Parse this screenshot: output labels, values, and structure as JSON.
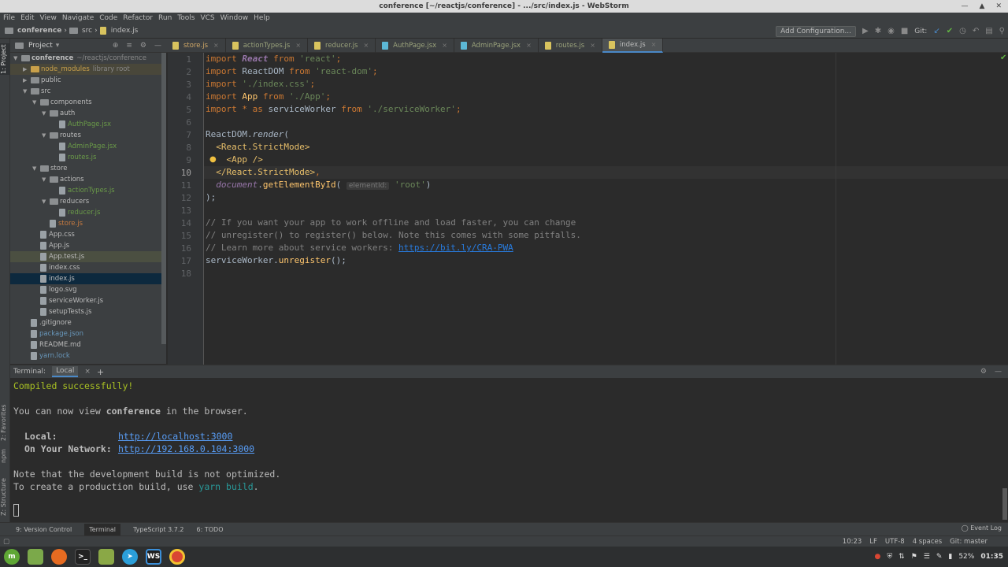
{
  "window": {
    "title": "conference [~/reactjs/conference] - .../src/index.js - WebStorm"
  },
  "menu": [
    "File",
    "Edit",
    "View",
    "Navigate",
    "Code",
    "Refactor",
    "Run",
    "Tools",
    "VCS",
    "Window",
    "Help"
  ],
  "breadcrumb": {
    "project": "conference",
    "folder": "src",
    "file": "index.js"
  },
  "toolbar": {
    "add_config": "Add Configuration...",
    "git_label": "Git:"
  },
  "left_tools": {
    "project": "1: Project",
    "favorites": "2: Favorites",
    "npm": "npm",
    "structure": "Z: Structure"
  },
  "project_panel": {
    "title": "Project"
  },
  "tree": [
    {
      "label": "conference",
      "extra": "~/reactjs/conference",
      "depth": 0,
      "arrow": "down",
      "kind": "folder",
      "bold": true
    },
    {
      "label": "node_modules",
      "extra": "library root",
      "depth": 1,
      "arrow": "right",
      "kind": "folder",
      "cls": "lib"
    },
    {
      "label": "public",
      "depth": 1,
      "arrow": "right",
      "kind": "folder"
    },
    {
      "label": "src",
      "depth": 1,
      "arrow": "down",
      "kind": "folder"
    },
    {
      "label": "components",
      "depth": 2,
      "arrow": "down",
      "kind": "folder"
    },
    {
      "label": "auth",
      "depth": 3,
      "arrow": "down",
      "kind": "folder"
    },
    {
      "label": "AuthPage.jsx",
      "depth": 4,
      "kind": "file",
      "color": "#6a9a48"
    },
    {
      "label": "routes",
      "depth": 3,
      "arrow": "down",
      "kind": "folder"
    },
    {
      "label": "AdminPage.jsx",
      "depth": 4,
      "kind": "file",
      "color": "#6a9a48"
    },
    {
      "label": "routes.js",
      "depth": 4,
      "kind": "file",
      "color": "#6a9a48"
    },
    {
      "label": "store",
      "depth": 2,
      "arrow": "down",
      "kind": "folder"
    },
    {
      "label": "actions",
      "depth": 3,
      "arrow": "down",
      "kind": "folder"
    },
    {
      "label": "actionTypes.js",
      "depth": 4,
      "kind": "file",
      "color": "#6a9a48"
    },
    {
      "label": "reducers",
      "depth": 3,
      "arrow": "down",
      "kind": "folder"
    },
    {
      "label": "reducer.js",
      "depth": 4,
      "kind": "file",
      "color": "#6a9a48"
    },
    {
      "label": "store.js",
      "depth": 3,
      "kind": "file",
      "color": "#c57a41"
    },
    {
      "label": "App.css",
      "depth": 2,
      "kind": "file",
      "color": "#bbbbbb"
    },
    {
      "label": "App.js",
      "depth": 2,
      "kind": "file",
      "color": "#bbbbbb"
    },
    {
      "label": "App.test.js",
      "depth": 2,
      "kind": "file",
      "color": "#bbbbbb",
      "cls": "sel"
    },
    {
      "label": "index.css",
      "depth": 2,
      "kind": "file",
      "color": "#bbbbbb"
    },
    {
      "label": "index.js",
      "depth": 2,
      "kind": "file",
      "color": "#bbbbbb",
      "cls": "hl"
    },
    {
      "label": "logo.svg",
      "depth": 2,
      "kind": "file",
      "color": "#bbbbbb"
    },
    {
      "label": "serviceWorker.js",
      "depth": 2,
      "kind": "file",
      "color": "#bbbbbb"
    },
    {
      "label": "setupTests.js",
      "depth": 2,
      "kind": "file",
      "color": "#bbbbbb"
    },
    {
      "label": ".gitignore",
      "depth": 1,
      "kind": "file",
      "color": "#bbbbbb"
    },
    {
      "label": "package.json",
      "depth": 1,
      "kind": "file",
      "color": "#6897bb"
    },
    {
      "label": "README.md",
      "depth": 1,
      "kind": "file",
      "color": "#bbbbbb"
    },
    {
      "label": "yarn.lock",
      "depth": 1,
      "kind": "file",
      "color": "#6897bb"
    }
  ],
  "tabs": [
    {
      "label": "store.js",
      "cls": "mod"
    },
    {
      "label": "actionTypes.js",
      "cls": ""
    },
    {
      "label": "reducer.js",
      "cls": ""
    },
    {
      "label": "AuthPage.jsx",
      "cls": ""
    },
    {
      "label": "AdminPage.jsx",
      "cls": ""
    },
    {
      "label": "routes.js",
      "cls": ""
    },
    {
      "label": "index.js",
      "cls": "active"
    }
  ],
  "code": {
    "l1": [
      "import",
      "React",
      "from",
      "'react'"
    ],
    "l2": [
      "import",
      "ReactDOM",
      "from",
      "'react-dom'"
    ],
    "l3": [
      "import",
      "'./index.css'"
    ],
    "l4": [
      "import",
      "App",
      "from",
      "'./App'"
    ],
    "l5": [
      "import",
      "* as",
      "serviceWorker",
      "from",
      "'./serviceWorker'"
    ],
    "l7": [
      "ReactDOM",
      "render"
    ],
    "l8": "<React.StrictMode>",
    "l9": "<App />",
    "l10": "</React.StrictMode>",
    "l11": [
      "document",
      "getElementById",
      "elementId:",
      "'root'"
    ],
    "l14": "// If you want your app to work offline and load faster, you can change",
    "l15": "// unregister() to register() below. Note this comes with some pitfalls.",
    "l16": [
      "// Learn more about service workers: ",
      "https://bit.ly/CRA-PWA"
    ],
    "l17": [
      "serviceWorker",
      "unregister"
    ]
  },
  "terminal": {
    "header": "Terminal:",
    "tab": "Local",
    "line1": "Compiled successfully!",
    "line2a": "You can now view ",
    "line2b": "conference",
    "line2c": " in the browser.",
    "local_label": "Local:",
    "local_url": "http://localhost:3000",
    "network_label": "On Your Network:",
    "network_url": "http://192.168.0.104:3000",
    "note": "Note that the development build is not optimized.",
    "build_a": "To create a production build, use ",
    "build_b": "yarn build",
    "build_c": "."
  },
  "bottom_tools": [
    "9: Version Control",
    "Terminal",
    "TypeScript 3.7.2",
    "6: TODO"
  ],
  "event_log": "Event Log",
  "status": {
    "pos": "10:23",
    "lf": "LF",
    "enc": "UTF-8",
    "indent": "4 spaces",
    "git": "Git: master"
  },
  "tray": {
    "battery": "52%",
    "time": "01:35"
  }
}
